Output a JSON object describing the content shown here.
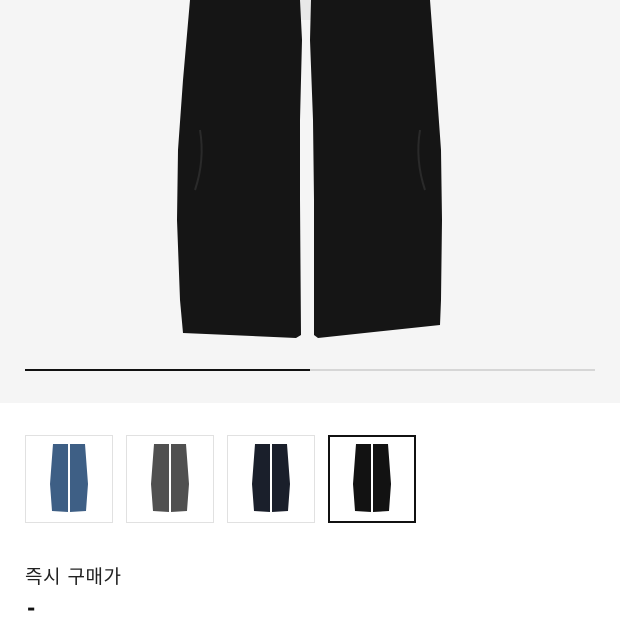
{
  "product_image": {
    "icon": "black-wide-jeans-image",
    "colors": {
      "background": "#f5f5f5",
      "pants": "#151515"
    }
  },
  "carousel": {
    "progress": 0.5,
    "colors": {
      "track": "#d6d6d6",
      "fill": "#111111"
    }
  },
  "thumbnails": [
    {
      "color": "#3e5f85",
      "icon": "blue-jeans-thumbnail",
      "selected": false
    },
    {
      "color": "#505050",
      "icon": "gray-jeans-thumbnail",
      "selected": false
    },
    {
      "color": "#1a1f2b",
      "icon": "navy-jeans-thumbnail",
      "selected": false
    },
    {
      "color": "#121212",
      "icon": "black-jeans-thumbnail",
      "selected": true
    }
  ],
  "price": {
    "label": "즉시 구매가",
    "value": "-"
  }
}
